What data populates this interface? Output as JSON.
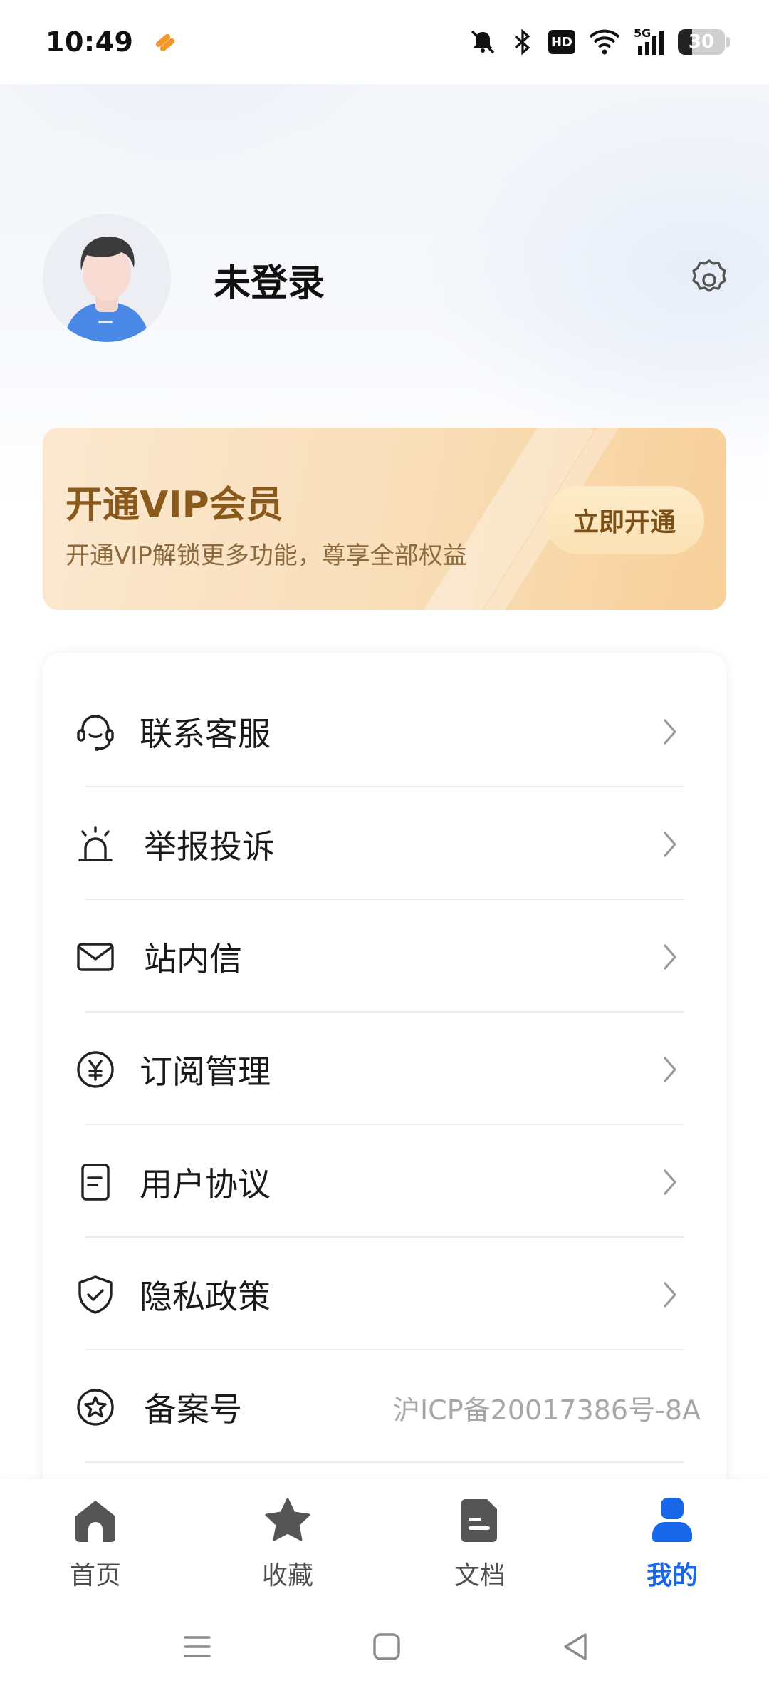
{
  "status_bar": {
    "time": "10:49",
    "battery": "30",
    "network": "5G",
    "hd": "HD"
  },
  "profile": {
    "username": "未登录"
  },
  "vip": {
    "title": "开通VIP会员",
    "subtitle": "开通VIP解锁更多功能，尊享全部权益",
    "button": "立即开通"
  },
  "menu": {
    "items": [
      {
        "label": "联系客服",
        "icon": "headset-icon"
      },
      {
        "label": "举报投诉",
        "icon": "alarm-icon"
      },
      {
        "label": "站内信",
        "icon": "mail-icon"
      },
      {
        "label": "订阅管理",
        "icon": "yen-icon"
      },
      {
        "label": "用户协议",
        "icon": "document-icon"
      },
      {
        "label": "隐私政策",
        "icon": "shield-icon"
      },
      {
        "label": "备案号",
        "icon": "star-circle-icon",
        "value": "沪ICP备20017386号-8A"
      }
    ]
  },
  "bottom_nav": {
    "items": [
      {
        "label": "首页",
        "icon": "home-icon",
        "active": false
      },
      {
        "label": "收藏",
        "icon": "star-icon",
        "active": false
      },
      {
        "label": "文档",
        "icon": "file-icon",
        "active": false
      },
      {
        "label": "我的",
        "icon": "user-icon",
        "active": true
      }
    ]
  },
  "colors": {
    "accent": "#1767e8",
    "vip_text": "#8a5a1c",
    "vip_bg": "#f9e0bd"
  }
}
